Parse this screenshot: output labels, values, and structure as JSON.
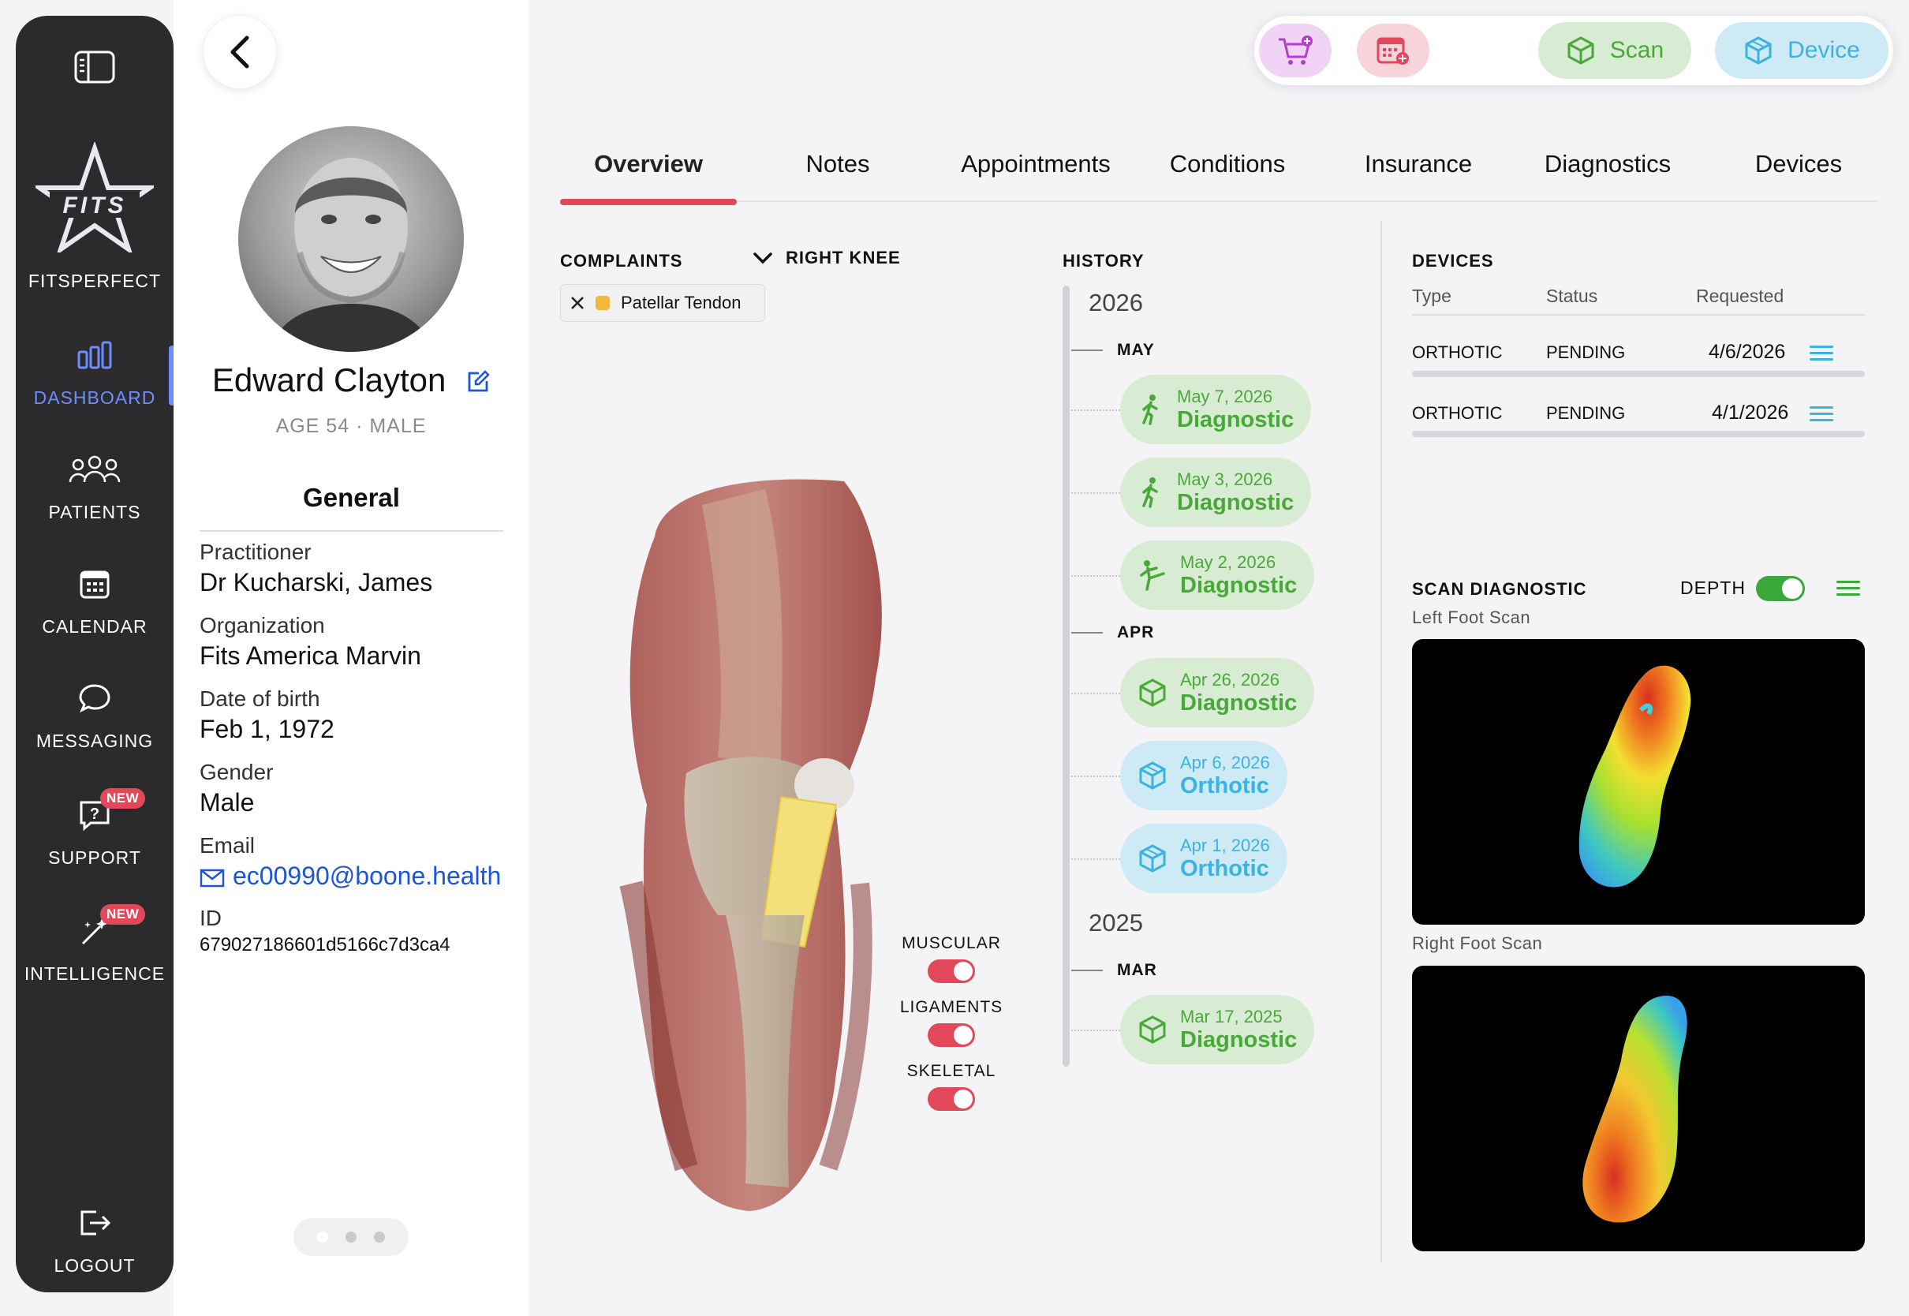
{
  "sidebar": {
    "brand_name": "FITSPERFECT",
    "logo_text": "FITS",
    "items": [
      {
        "label": "DASHBOARD",
        "icon": "bar-chart-icon",
        "active": true
      },
      {
        "label": "PATIENTS",
        "icon": "people-icon"
      },
      {
        "label": "CALENDAR",
        "icon": "calendar-icon"
      },
      {
        "label": "MESSAGING",
        "icon": "chat-bubble-icon"
      },
      {
        "label": "SUPPORT",
        "icon": "help-bubble-icon",
        "badge": "NEW"
      },
      {
        "label": "INTELLIGENCE",
        "icon": "magic-wand-icon",
        "badge": "NEW"
      },
      {
        "label": "LOGOUT",
        "icon": "logout-icon"
      }
    ]
  },
  "patient": {
    "name": "Edward Clayton",
    "meta": "AGE 54 · MALE",
    "section_title": "General",
    "fields": [
      {
        "key": "Practitioner",
        "value": "Dr Kucharski, James"
      },
      {
        "key": "Organization",
        "value": "Fits America Marvin"
      },
      {
        "key": "Date of birth",
        "value": "Feb 1, 1972"
      },
      {
        "key": "Gender",
        "value": "Male"
      },
      {
        "key": "Email",
        "value": "ec00990@boone.health"
      },
      {
        "key": "ID",
        "value": "679027186601d5166c7d3ca4"
      }
    ]
  },
  "actions": {
    "scan_label": "Scan",
    "device_label": "Device"
  },
  "tabs": [
    "Overview",
    "Notes",
    "Appointments",
    "Conditions",
    "Insurance",
    "Diagnostics",
    "Devices"
  ],
  "complaints": {
    "heading": "COMPLAINTS",
    "selected_area": "RIGHT KNEE",
    "chips": [
      "Patellar Tendon"
    ]
  },
  "layers": [
    {
      "label": "MUSCULAR",
      "on": true
    },
    {
      "label": "LIGAMENTS",
      "on": true
    },
    {
      "label": "SKELETAL",
      "on": true
    }
  ],
  "history": {
    "heading": "HISTORY",
    "groups": [
      {
        "year": "2026",
        "months": [
          {
            "month": "MAY",
            "items": [
              {
                "date": "May 7, 2026",
                "type": "Diagnostic",
                "icon": "walking-person-icon"
              },
              {
                "date": "May 3, 2026",
                "type": "Diagnostic",
                "icon": "walking-person-icon"
              },
              {
                "date": "May 2, 2026",
                "type": "Diagnostic",
                "icon": "kicking-person-icon"
              }
            ]
          },
          {
            "month": "APR",
            "items": [
              {
                "date": "Apr 26, 2026",
                "type": "Diagnostic",
                "icon": "scan-cube-icon"
              },
              {
                "date": "Apr 6, 2026",
                "type": "Orthotic",
                "icon": "box-icon"
              },
              {
                "date": "Apr 1, 2026",
                "type": "Orthotic",
                "icon": "box-icon"
              }
            ]
          }
        ]
      },
      {
        "year": "2025",
        "months": [
          {
            "month": "MAR",
            "items": [
              {
                "date": "Mar 17, 2025",
                "type": "Diagnostic",
                "icon": "scan-cube-icon"
              }
            ]
          }
        ]
      }
    ]
  },
  "devices": {
    "heading": "DEVICES",
    "columns": [
      "Type",
      "Status",
      "Requested"
    ],
    "rows": [
      {
        "type": "ORTHOTIC",
        "status": "PENDING",
        "requested": "4/6/2026"
      },
      {
        "type": "ORTHOTIC",
        "status": "PENDING",
        "requested": "4/1/2026"
      }
    ]
  },
  "scan_diagnostic": {
    "heading": "SCAN DIAGNOSTIC",
    "depth_label": "DEPTH",
    "depth_on": true,
    "left_label": "Left Foot Scan",
    "right_label": "Right Foot Scan"
  },
  "colors": {
    "accent_red": "#e2485a",
    "accent_blue": "#6f8dff",
    "diag_green": "#4aa83a",
    "orth_blue": "#3ab3e2"
  }
}
